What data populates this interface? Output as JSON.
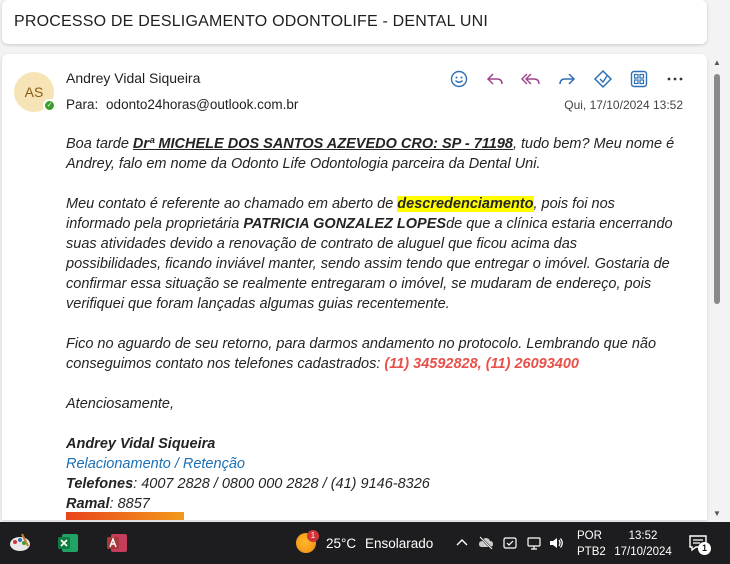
{
  "subject": "PROCESSO DE DESLIGAMENTO ODONTOLIFE - DENTAL UNI",
  "message": {
    "avatar_initials": "AS",
    "sender": "Andrey Vidal Siqueira",
    "to_label": "Para:",
    "to_address": "odonto24horas@outlook.com.br",
    "date": "Qui, 17/10/2024 13:52",
    "actions": [
      "emoji-icon",
      "reply-icon",
      "reply-all-icon",
      "forward-icon",
      "tag-icon",
      "apps-icon",
      "more-icon"
    ]
  },
  "body": {
    "p1_a": "Boa tarde ",
    "p1_name": "Drª MICHELE DOS SANTOS AZEVEDO CRO: SP - 71198",
    "p1_b": ", tudo bem? Meu nome é Andrey, falo em nome da Odonto Life Odontologia parceira da Dental Uni.",
    "p2_a": "Meu contato é referente ao chamado em aberto de ",
    "p2_highlight": "descredenciamento",
    "p2_b": ", pois foi nos informado pela proprietária ",
    "p2_owner": "PATRICIA GONZALEZ LOPES",
    "p2_c": "de que a clínica estaria encerrando suas atividades devido a renovação de contrato de aluguel que ficou acima das possibilidades, ficando inviável manter, sendo assim tendo que entregar o imóvel. Gostaria de confirmar essa situação se realmente entregaram o imóvel, se mudaram de endereço, pois verifiquei que foram lançadas algumas guias recentemente.",
    "p3_a": "Fico no aguardo de seu retorno, para darmos andamento no protocolo. Lembrando que não conseguimos contato nos telefones cadastrados: ",
    "p3_phones": "(11) 34592828, (11) 26093400",
    "closing": "Atenciosamente,",
    "sig_name": "Andrey Vidal Siqueira",
    "sig_role": "Relacionamento / Retenção",
    "sig_phones_label": "Telefones",
    "sig_phones": ": 4007 2828 / 0800 000 2828 / (41) 9146-8326",
    "sig_ext_label": "Ramal",
    "sig_ext": ": 8857"
  },
  "taskbar": {
    "apps": [
      "paint-icon",
      "excel-icon",
      "access-icon"
    ],
    "weather_badge": "1",
    "temperature": "25°C",
    "condition": "Ensolarado",
    "lang_line1": "POR",
    "lang_line2": "PTB2",
    "time": "13:52",
    "date": "17/10/2024",
    "notifications": "1"
  },
  "colors": {
    "highlight": "#ffff00",
    "phone_red": "#e8504a",
    "signature_blue": "#1a6fb5",
    "icon_blue": "#2f6fb5",
    "taskbar_bg": "#1d1d1f"
  }
}
